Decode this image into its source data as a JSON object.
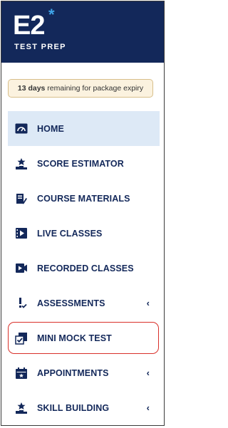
{
  "brand": {
    "logo_text": "E2",
    "logo_star": "*",
    "subtitle": "TEST PREP"
  },
  "notice": {
    "days": "13 days",
    "rest": " remaining for package expiry"
  },
  "nav": [
    {
      "label": "HOME",
      "icon": "dashboard-icon",
      "active": true,
      "chevron": ""
    },
    {
      "label": "SCORE ESTIMATOR",
      "icon": "award-podium-icon",
      "active": false,
      "chevron": ""
    },
    {
      "label": "COURSE MATERIALS",
      "icon": "book-pen-icon",
      "active": false,
      "chevron": ""
    },
    {
      "label": "LIVE CLASSES",
      "icon": "live-video-icon",
      "active": false,
      "chevron": ""
    },
    {
      "label": "RECORDED CLASSES",
      "icon": "video-camera-icon",
      "active": false,
      "chevron": ""
    },
    {
      "label": "ASSESSMENTS",
      "icon": "assessment-icon",
      "active": false,
      "chevron": "‹"
    },
    {
      "label": "MINI MOCK TEST",
      "icon": "checklist-icon",
      "active": false,
      "chevron": "",
      "highlighted": true
    },
    {
      "label": "APPOINTMENTS",
      "icon": "calendar-icon",
      "active": false,
      "chevron": "‹"
    },
    {
      "label": "SKILL BUILDING",
      "icon": "skill-podium-icon",
      "active": false,
      "chevron": "‹"
    }
  ],
  "colors": {
    "navy": "#13285a",
    "accent_star": "#3fa5ea",
    "active_bg": "#dde9f6",
    "notice_bg": "#fbf2df",
    "notice_border": "#d8bf8a",
    "highlight": "#d9302a"
  }
}
